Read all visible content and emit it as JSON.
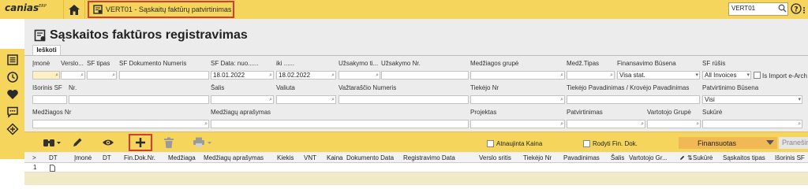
{
  "topbar": {
    "logo": "canias",
    "logo_sup": "ERP",
    "tab_title": "VERT01 - Sąskaitų faktūrų patvirtinimas",
    "search_value": "VERT01"
  },
  "page": {
    "title": "Sąskaitos faktūros registravimas",
    "subtab": "Ieškoti"
  },
  "filters": {
    "row1_labels": [
      "Įmonė",
      "Verslo...",
      "SF tipas",
      "SF Dokumento Numeris",
      "SF Data: nuo......",
      "iki ......",
      "Užsakymo ti...",
      "Užsakymo Nr.",
      "Medžiagos grupė",
      "Medž.Tipas",
      "Finansavimo Būsena",
      "SF rūšis"
    ],
    "date_from": "18.01.2022",
    "date_to": "18.02.2022",
    "financing_status": "Visa stat.",
    "sf_kind": "All Invoices",
    "import_label": "Is Import e-Arch",
    "row2_labels": [
      "Išorinis SF",
      "Nr.",
      "Šalis",
      "Valiuta",
      "Važtaraščio Numeris",
      "Tiekėjo Nr",
      "Tiekėjo Pavadinimas / Krovėjo Pavadinimas",
      "Patvirtinimo Būsena"
    ],
    "approval_status": "Visi",
    "row3_labels": [
      "Medžiagos Nr",
      "Medžiagų aprašymas",
      "Projektas",
      "Patvirtinimas",
      "Vartotojo Grupė",
      "Sukūrė"
    ]
  },
  "toolbar": {
    "renewed_label": "Atnaujinta Kaina",
    "show_fin_label": "Rodyti Fin. Dok.",
    "financing_button": "Finansuotas",
    "prane_button": "Pranešima"
  },
  "grid": {
    "columns": [
      ">",
      "DT",
      "Įmonė",
      "DT",
      "Fin.Dok.Nr.",
      "Medžiaga",
      "Medžiagų aprašymas",
      "Kiekis",
      "VNT",
      "Kaina",
      "Dokumento Data",
      "Registravimo Data",
      "Verslo sritis",
      "Tiekėjo Nr",
      "Pavadinimas",
      "Šalis",
      "Vartotojo Gr...",
      "Sukūrė",
      "Sąskaitos tipas",
      "Išorinis SF"
    ],
    "row_index": "1"
  },
  "colors": {
    "accent_yellow": "#f6d55c",
    "highlight_red": "#d43c34",
    "financing_orange": "#f0b956"
  }
}
